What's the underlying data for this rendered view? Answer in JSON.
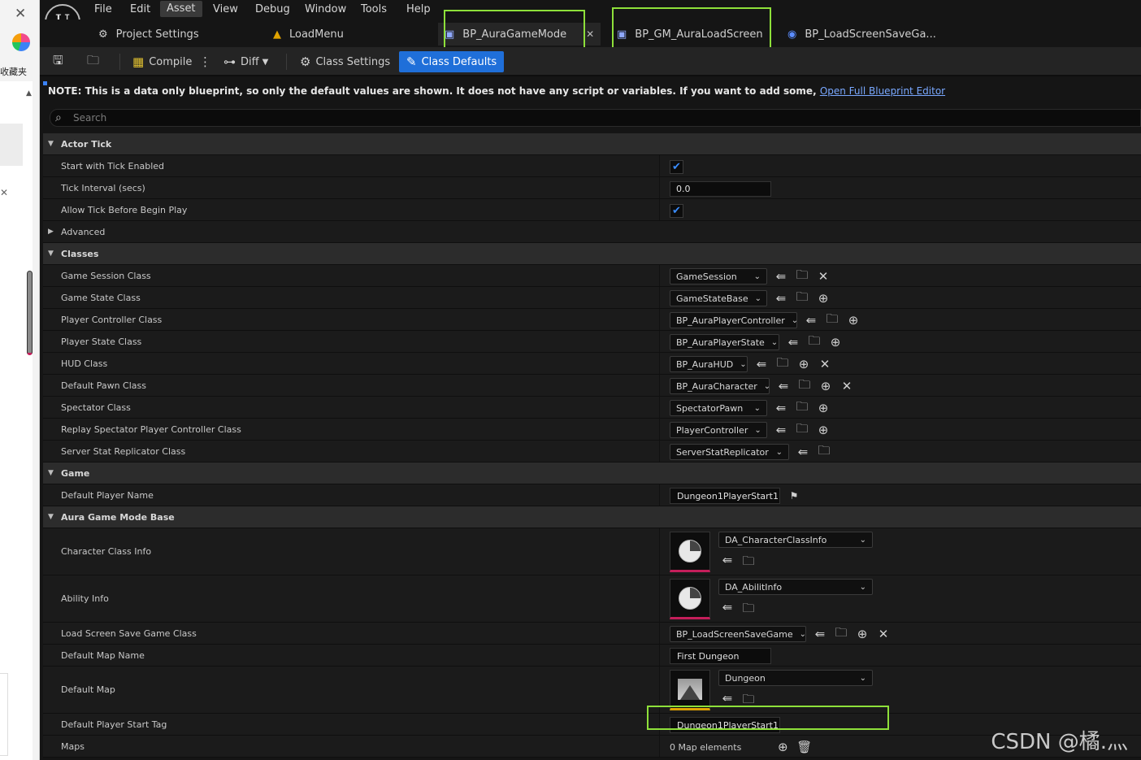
{
  "browser_strip": {
    "favorites_label": "收藏夹"
  },
  "menu": [
    "File",
    "Edit",
    "Asset",
    "View",
    "Debug",
    "Window",
    "Tools",
    "Help"
  ],
  "menu_active": "Asset",
  "tabs": {
    "project_settings": "Project Settings",
    "load_menu": "LoadMenu",
    "gamemode": "BP_AuraGameMode",
    "gm_loadscreen": "BP_GM_AuraLoadScreen",
    "savegame": "BP_LoadScreenSaveGa..."
  },
  "toolbar": {
    "compile": "Compile",
    "diff": "Diff",
    "class_settings": "Class Settings",
    "class_defaults": "Class Defaults"
  },
  "note": {
    "text": "NOTE: This is a data only blueprint, so only the default values are shown.  It does not have any script or variables.  If you want to add some, ",
    "link": "Open Full Blueprint Editor"
  },
  "search": {
    "placeholder": "Search"
  },
  "sections": {
    "actor_tick": "Actor Tick",
    "classes": "Classes",
    "game": "Game",
    "aura": "Aura Game Mode Base"
  },
  "props": {
    "start_tick": "Start with Tick Enabled",
    "tick_interval": "Tick Interval (secs)",
    "tick_interval_val": "0.0",
    "allow_tick": "Allow Tick Before Begin Play",
    "advanced": "Advanced",
    "game_session": "Game Session Class",
    "game_session_val": "GameSession",
    "game_state": "Game State Class",
    "game_state_val": "GameStateBase",
    "player_controller": "Player Controller Class",
    "player_controller_val": "BP_AuraPlayerController",
    "player_state": "Player State Class",
    "player_state_val": "BP_AuraPlayerState",
    "hud": "HUD Class",
    "hud_val": "BP_AuraHUD",
    "default_pawn": "Default Pawn Class",
    "default_pawn_val": "BP_AuraCharacter",
    "spectator": "Spectator Class",
    "spectator_val": "SpectatorPawn",
    "replay_spectator": "Replay Spectator Player Controller Class",
    "replay_spectator_val": "PlayerController",
    "server_stat": "Server Stat Replicator Class",
    "server_stat_val": "ServerStatReplicator",
    "default_player_name": "Default Player Name",
    "default_player_name_val": "Dungeon1PlayerStart1",
    "character_class_info": "Character Class Info",
    "character_class_info_val": "DA_CharacterClassInfo",
    "ability_info": "Ability Info",
    "ability_info_val": "DA_AbilitInfo",
    "load_screen_save": "Load Screen Save Game Class",
    "load_screen_save_val": "BP_LoadScreenSaveGame",
    "default_map_name": "Default Map Name",
    "default_map_name_val": "First Dungeon",
    "default_map": "Default Map",
    "default_map_val": "Dungeon",
    "default_player_start_tag": "Default Player Start Tag",
    "default_player_start_tag_val": "Dungeon1PlayerStart1",
    "maps": "Maps",
    "maps_val": "0 Map elements"
  },
  "watermark": "CSDN @橘.灬",
  "colors": {
    "accent": "#1f6fd9",
    "highlight": "#8ee03a",
    "thumb_asset": "#c41e5a",
    "thumb_map": "#e0a300"
  }
}
